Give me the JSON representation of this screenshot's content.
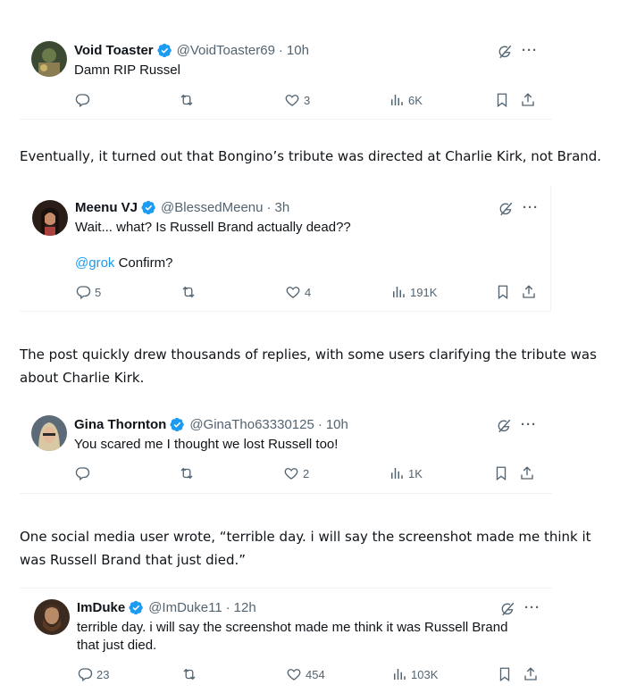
{
  "tweets": [
    {
      "name": "Void Toaster",
      "handle": "@VoidToaster69",
      "time": "10h",
      "text": "Damn RIP Russel",
      "replies": "",
      "likes": "3",
      "views": "6K"
    },
    {
      "name": "Meenu VJ",
      "handle": "@BlessedMeenu",
      "time": "3h",
      "text": "Wait... what? Is Russell Brand actually dead??",
      "mention": "@grok",
      "text2": "Confirm?",
      "replies": "5",
      "likes": "4",
      "views": "191K"
    },
    {
      "name": "Gina Thornton",
      "handle": "@GinaTho63330125",
      "time": "10h",
      "text": "You scared me I thought we lost Russell too!",
      "replies": "",
      "likes": "2",
      "views": "1K"
    },
    {
      "name": "ImDuke",
      "handle": "@ImDuke11",
      "time": "12h",
      "text": "terrible day. i will say the screenshot made me think it was Russell Brand that just died.",
      "replies": "23",
      "likes": "454",
      "views": "103K"
    }
  ],
  "paragraphs": [
    "Eventually, it turned out that Bongino’s tribute was directed at Charlie Kirk, not Brand.",
    "The post quickly drew thousands of replies, with some users clarifying the tribute was about Charlie Kirk.",
    "One social media user wrote, “terrible day. i will say the screenshot made me think it was Russell Brand that just died.”"
  ],
  "colors": {
    "accent": "#1d9bf0",
    "secondary": "#536471",
    "divider": "#eff3f4"
  },
  "icons": [
    "verified-badge-icon",
    "grok-icon",
    "more-icon",
    "reply-icon",
    "repost-icon",
    "like-icon",
    "views-icon",
    "bookmark-icon",
    "share-icon"
  ]
}
